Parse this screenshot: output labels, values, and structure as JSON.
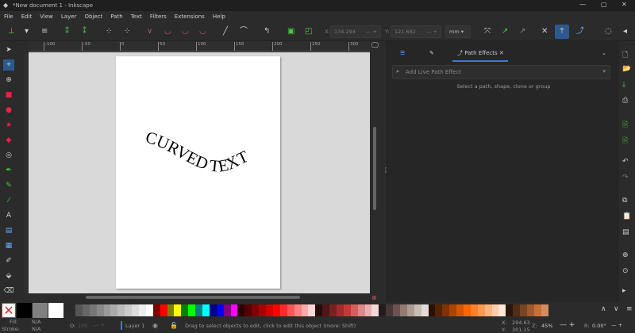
{
  "window": {
    "title": "*New document 1 - Inkscape",
    "min": "—",
    "max": "▢",
    "close": "✕"
  },
  "menu": [
    "File",
    "Edit",
    "View",
    "Layer",
    "Object",
    "Path",
    "Text",
    "Filters",
    "Extensions",
    "Help"
  ],
  "toolbar": {
    "x_label": "X:",
    "x_value": "134.294",
    "y_label": "Y:",
    "y_value": "121.682",
    "unit": "mm"
  },
  "ruler": [
    "-100",
    "-50",
    "0",
    "50",
    "100",
    "150",
    "200",
    "250",
    "300"
  ],
  "canvas": {
    "curved_text": "CURVED TEXT"
  },
  "panel": {
    "tabs": [
      "Layers",
      "Fill",
      "Path Effects"
    ],
    "active_tab": "Path Effects",
    "close": "✕",
    "search_placeholder": "Add Live Path Effect",
    "hint": "Select a path, shape, clone or group"
  },
  "palette": {
    "colors": [
      "#555",
      "#666",
      "#777",
      "#888",
      "#999",
      "#aaa",
      "#bbb",
      "#ccc",
      "#ddd",
      "#eee",
      "#fff",
      "#800000",
      "#ff0000",
      "#808000",
      "#ffff00",
      "#008000",
      "#00ff00",
      "#008080",
      "#00ffff",
      "#000080",
      "#0000ff",
      "#800080",
      "#ff00ff",
      "#2b0000",
      "#550000",
      "#800000",
      "#aa0000",
      "#d40000",
      "#ff0000",
      "#ff2a2a",
      "#ff5555",
      "#ff8080",
      "#ffaaaa",
      "#ffd5d5",
      "#280b0b",
      "#501616",
      "#782121",
      "#a02c2c",
      "#c83737",
      "#d35f5f",
      "#de8787",
      "#e9afaf",
      "#f4d7d7",
      "#241c1c",
      "#483737",
      "#6c5353",
      "#917c6f",
      "#ac9d93",
      "#c8bcb7",
      "#e3dbdb",
      "#2b1100",
      "#552200",
      "#803300",
      "#aa4400",
      "#d45500",
      "#ff6600",
      "#ff7f2a",
      "#ff9955",
      "#ffb380",
      "#ffccaa",
      "#ffe6d5",
      "#28170b",
      "#502d16",
      "#784421",
      "#a05a2c",
      "#c87137",
      "#d38d5f"
    ]
  },
  "status": {
    "fill_label": "Fill:",
    "fill_value": "N/A",
    "stroke_label": "Stroke:",
    "stroke_value": "N/A",
    "opacity_label": "O:",
    "opacity_value": "100",
    "layer": "Layer 1",
    "message": "Drag to select objects to edit, click to edit this object (more: Shift)",
    "x_label": "X:",
    "x_value": "294.63",
    "y_label": "Y:",
    "y_value": "301.15",
    "zoom_label": "Z:",
    "zoom_value": "45%",
    "rot_label": "R:",
    "rot_value": "0.00°"
  }
}
